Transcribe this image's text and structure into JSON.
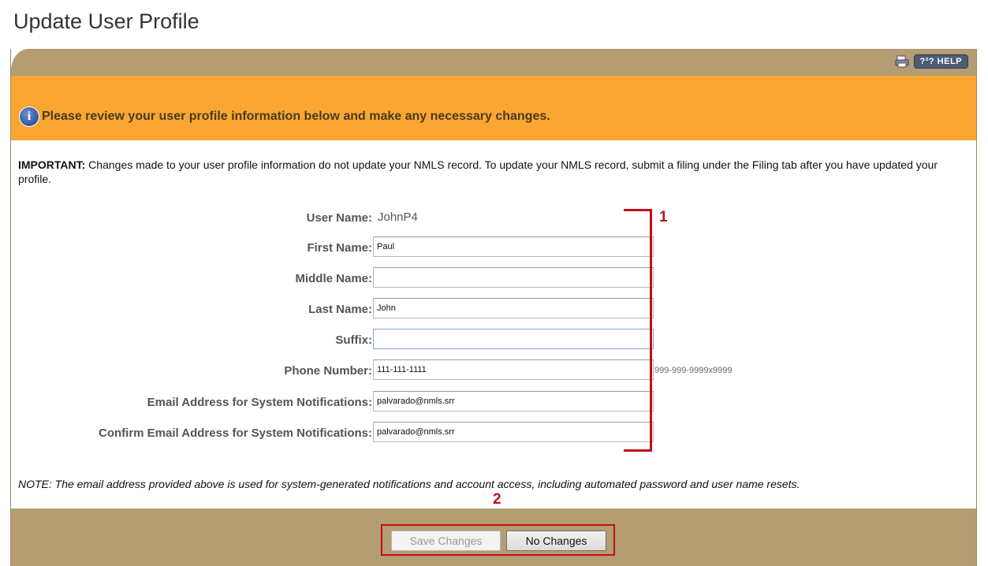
{
  "page": {
    "title": "Update User Profile"
  },
  "toolbar": {
    "help_label": "?²? HELP"
  },
  "banner": {
    "message": "Please review your user profile information below and make any necessary changes."
  },
  "important": {
    "prefix": "IMPORTANT:",
    "text": " Changes made to your user profile information do not update your NMLS record. To update your NMLS record, submit a filing under the Filing tab after you have updated your profile."
  },
  "form": {
    "user_name": {
      "label": "User Name:",
      "value": "JohnP4"
    },
    "first_name": {
      "label": "First Name:",
      "value": "Paul"
    },
    "middle_name": {
      "label": "Middle Name:",
      "value": ""
    },
    "last_name": {
      "label": "Last Name:",
      "value": "John"
    },
    "suffix": {
      "label": "Suffix:",
      "value": ""
    },
    "phone": {
      "label": "Phone Number:",
      "value": "111-111-1111",
      "hint": "999-999-9999x9999"
    },
    "email": {
      "label": "Email Address for System Notifications:",
      "value": "palvarado@nmls.srr"
    },
    "confirm_email": {
      "label": "Confirm Email Address for System Notifications:",
      "value": "palvarado@nmls.srr"
    }
  },
  "annotations": {
    "marker1": "1",
    "marker2": "2",
    "color": "#c0101a"
  },
  "note": "NOTE: The email address provided above is used for system-generated notifications and account access, including automated password and user name resets.",
  "buttons": {
    "save_label": "Save Changes",
    "save_disabled": true,
    "no_changes_label": "No Changes"
  },
  "colors": {
    "banner": "#f9a633",
    "bar": "#b49c73"
  }
}
